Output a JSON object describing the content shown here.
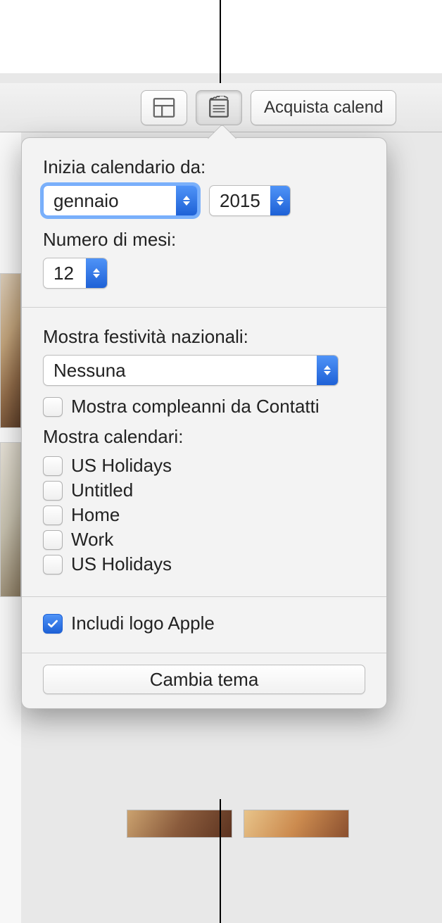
{
  "toolbar": {
    "buy_label": "Acquista calend"
  },
  "popover": {
    "start_label": "Inizia calendario da:",
    "start_month": "gennaio",
    "start_year": "2015",
    "months_label": "Numero di mesi:",
    "months_value": "12",
    "holidays_label": "Mostra festività nazionali:",
    "holidays_value": "Nessuna",
    "birthdays_label": "Mostra compleanni da Contatti",
    "show_calendars_label": "Mostra calendari:",
    "calendars": [
      "US Holidays",
      "Untitled",
      "Home",
      "Work",
      "US Holidays"
    ],
    "include_logo_label": "Includi logo Apple",
    "change_theme_label": "Cambia tema"
  }
}
